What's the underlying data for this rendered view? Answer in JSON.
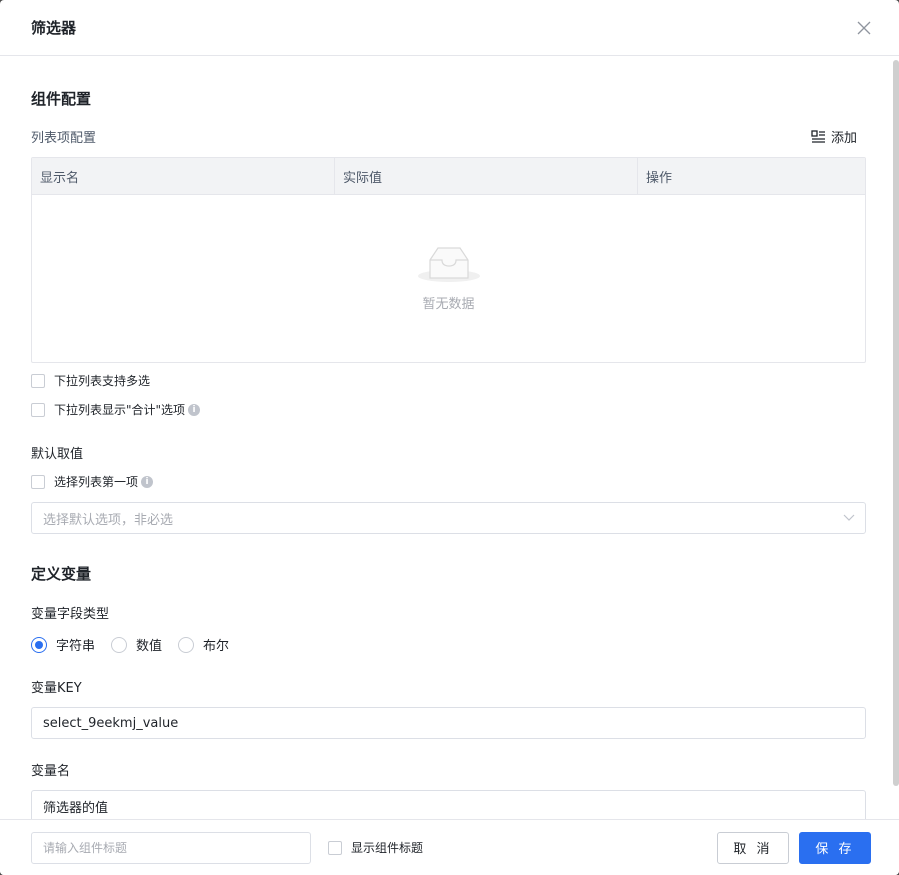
{
  "dialog": {
    "title": "筛选器"
  },
  "component_config": {
    "heading": "组件配置",
    "list_config_label": "列表项配置",
    "add_label": "添加",
    "table": {
      "columns": [
        "显示名",
        "实际值",
        "操作"
      ],
      "empty_text": "暂无数据"
    },
    "options": [
      {
        "label": "下拉列表支持多选",
        "checked": false,
        "info": false
      },
      {
        "label": "下拉列表显示\"合计\"选项",
        "checked": false,
        "info": true
      }
    ]
  },
  "default_value": {
    "label": "默认取值",
    "first_item": {
      "label": "选择列表第一项",
      "checked": false
    },
    "select_placeholder": "选择默认选项，非必选"
  },
  "variable": {
    "heading": "定义变量",
    "type_label": "变量字段类型",
    "types": [
      {
        "label": "字符串",
        "selected": true
      },
      {
        "label": "数值",
        "selected": false
      },
      {
        "label": "布尔",
        "selected": false
      }
    ],
    "key_label": "变量KEY",
    "key_value": "select_9eekmj_value",
    "name_label": "变量名",
    "name_value": "筛选器的值"
  },
  "footer": {
    "title_placeholder": "请输入组件标题",
    "show_title_label": "显示组件标题",
    "cancel_label": "取 消",
    "save_label": "保 存"
  },
  "colors": {
    "primary": "#2a6ff0",
    "border": "#dcdfe6",
    "header_bg": "#f2f3f5"
  }
}
